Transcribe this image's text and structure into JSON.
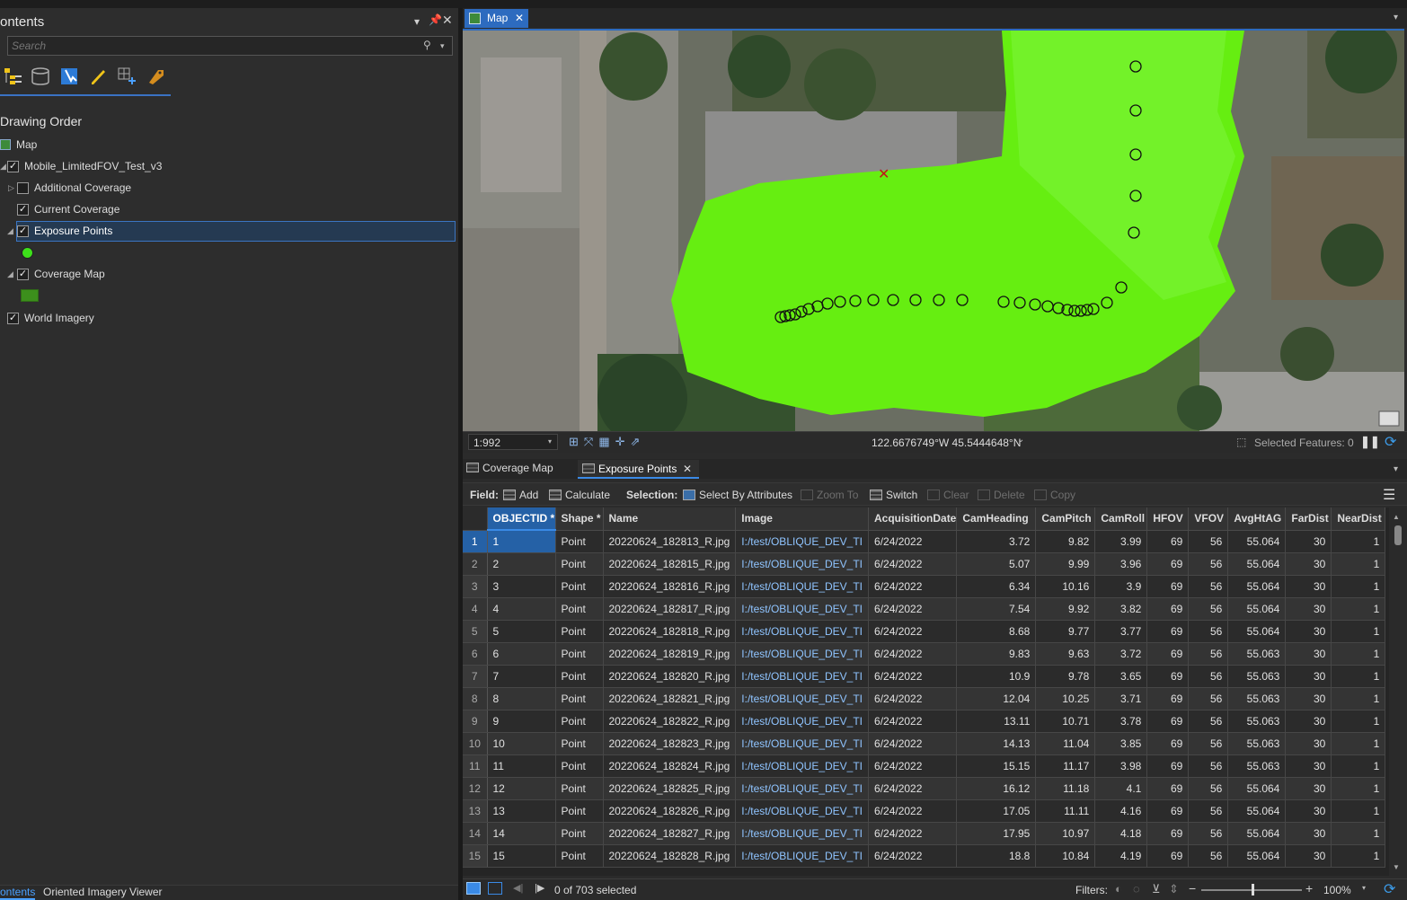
{
  "contents": {
    "title": "ontents",
    "search_placeholder": "Search",
    "section_title": "Drawing Order",
    "tree": [
      {
        "label": "Map"
      },
      {
        "label": "Mobile_LimitedFOV_Test_v3"
      },
      {
        "label": "Additional Coverage"
      },
      {
        "label": "Current Coverage"
      },
      {
        "label": "Exposure Points"
      },
      {
        "label": "Coverage Map"
      },
      {
        "label": "World Imagery"
      }
    ],
    "bottom_tabs": [
      "ontents",
      "Oriented Imagery Viewer"
    ]
  },
  "map": {
    "tab_label": "Map",
    "scale": "1:992",
    "coordinates": "122.6676749°W 45.5444648°N",
    "selected_features": "Selected Features: 0",
    "colors": {
      "coverage": "#66ee11",
      "accent": "#2d6bbf"
    }
  },
  "table": {
    "tabs": [
      "Coverage Map",
      "Exposure Points"
    ],
    "field_label": "Field:",
    "add_label": "Add",
    "calculate_label": "Calculate",
    "selection_label": "Selection:",
    "select_by_attr_label": "Select By Attributes",
    "zoom_to_label": "Zoom To",
    "switch_label": "Switch",
    "clear_label": "Clear",
    "delete_label": "Delete",
    "copy_label": "Copy",
    "columns": [
      "OBJECTID *",
      "Shape *",
      "Name",
      "Image",
      "AcquisitionDate",
      "CamHeading",
      "CamPitch",
      "CamRoll",
      "HFOV",
      "VFOV",
      "AvgHtAG",
      "FarDist",
      "NearDist"
    ],
    "rows": [
      [
        "1",
        "Point",
        "20220624_182813_R.jpg",
        "I:/test/OBLIQUE_DEV_TI",
        "6/24/2022",
        "3.72",
        "9.82",
        "3.99",
        "69",
        "56",
        "55.064",
        "30",
        "1"
      ],
      [
        "2",
        "Point",
        "20220624_182815_R.jpg",
        "I:/test/OBLIQUE_DEV_TI",
        "6/24/2022",
        "5.07",
        "9.99",
        "3.96",
        "69",
        "56",
        "55.064",
        "30",
        "1"
      ],
      [
        "3",
        "Point",
        "20220624_182816_R.jpg",
        "I:/test/OBLIQUE_DEV_TI",
        "6/24/2022",
        "6.34",
        "10.16",
        "3.9",
        "69",
        "56",
        "55.064",
        "30",
        "1"
      ],
      [
        "4",
        "Point",
        "20220624_182817_R.jpg",
        "I:/test/OBLIQUE_DEV_TI",
        "6/24/2022",
        "7.54",
        "9.92",
        "3.82",
        "69",
        "56",
        "55.064",
        "30",
        "1"
      ],
      [
        "5",
        "Point",
        "20220624_182818_R.jpg",
        "I:/test/OBLIQUE_DEV_TI",
        "6/24/2022",
        "8.68",
        "9.77",
        "3.77",
        "69",
        "56",
        "55.064",
        "30",
        "1"
      ],
      [
        "6",
        "Point",
        "20220624_182819_R.jpg",
        "I:/test/OBLIQUE_DEV_TI",
        "6/24/2022",
        "9.83",
        "9.63",
        "3.72",
        "69",
        "56",
        "55.063",
        "30",
        "1"
      ],
      [
        "7",
        "Point",
        "20220624_182820_R.jpg",
        "I:/test/OBLIQUE_DEV_TI",
        "6/24/2022",
        "10.9",
        "9.78",
        "3.65",
        "69",
        "56",
        "55.063",
        "30",
        "1"
      ],
      [
        "8",
        "Point",
        "20220624_182821_R.jpg",
        "I:/test/OBLIQUE_DEV_TI",
        "6/24/2022",
        "12.04",
        "10.25",
        "3.71",
        "69",
        "56",
        "55.063",
        "30",
        "1"
      ],
      [
        "9",
        "Point",
        "20220624_182822_R.jpg",
        "I:/test/OBLIQUE_DEV_TI",
        "6/24/2022",
        "13.11",
        "10.71",
        "3.78",
        "69",
        "56",
        "55.063",
        "30",
        "1"
      ],
      [
        "10",
        "Point",
        "20220624_182823_R.jpg",
        "I:/test/OBLIQUE_DEV_TI",
        "6/24/2022",
        "14.13",
        "11.04",
        "3.85",
        "69",
        "56",
        "55.063",
        "30",
        "1"
      ],
      [
        "11",
        "Point",
        "20220624_182824_R.jpg",
        "I:/test/OBLIQUE_DEV_TI",
        "6/24/2022",
        "15.15",
        "11.17",
        "3.98",
        "69",
        "56",
        "55.063",
        "30",
        "1"
      ],
      [
        "12",
        "Point",
        "20220624_182825_R.jpg",
        "I:/test/OBLIQUE_DEV_TI",
        "6/24/2022",
        "16.12",
        "11.18",
        "4.1",
        "69",
        "56",
        "55.064",
        "30",
        "1"
      ],
      [
        "13",
        "Point",
        "20220624_182826_R.jpg",
        "I:/test/OBLIQUE_DEV_TI",
        "6/24/2022",
        "17.05",
        "11.11",
        "4.16",
        "69",
        "56",
        "55.064",
        "30",
        "1"
      ],
      [
        "14",
        "Point",
        "20220624_182827_R.jpg",
        "I:/test/OBLIQUE_DEV_TI",
        "6/24/2022",
        "17.95",
        "10.97",
        "4.18",
        "69",
        "56",
        "55.064",
        "30",
        "1"
      ],
      [
        "15",
        "Point",
        "20220624_182828_R.jpg",
        "I:/test/OBLIQUE_DEV_TI",
        "6/24/2022",
        "18.8",
        "10.84",
        "4.19",
        "69",
        "56",
        "55.064",
        "30",
        "1"
      ]
    ],
    "status": "0 of 703 selected",
    "filters_label": "Filters:",
    "zoom": "100%"
  }
}
